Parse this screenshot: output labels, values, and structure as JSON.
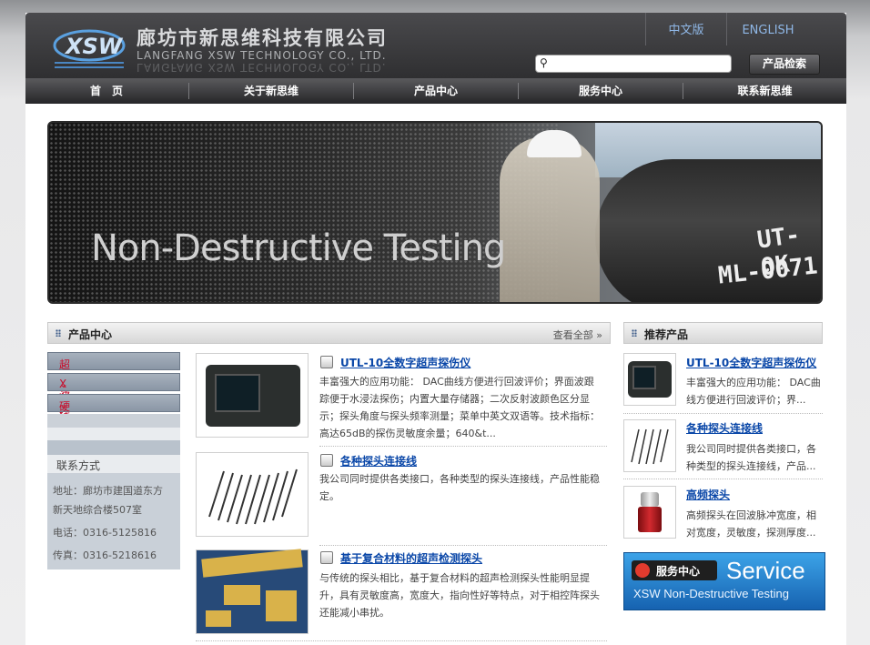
{
  "header": {
    "company_cn": "廊坊市新思维科技有限公司",
    "company_en": "LANGFANG XSW TECHNOLOGY CO., LTD.",
    "lang_cn": "中文版",
    "lang_en": "ENGLISH",
    "search_placeholder": "",
    "search_button": "产品检索"
  },
  "nav": [
    "首　页",
    "关于新思维",
    "产品中心",
    "服务中心",
    "联系新思维"
  ],
  "banner": {
    "title": "Non-Destructive Testing",
    "marks": [
      "UT-OK",
      "ML-0071"
    ]
  },
  "product_center": {
    "title": "产品中心",
    "more": "查看全部"
  },
  "categories": [
    "超声波产品",
    "X射线产品",
    "硬度计"
  ],
  "contact": {
    "title": "联系方式",
    "address_line1": "地址：廊坊市建国道东方",
    "address_line2": "新天地综合楼507室",
    "phone": "电话：0316-5125816",
    "fax": "传真：0316-5218616"
  },
  "products": [
    {
      "title": "UTL-10全数字超声探伤仪",
      "desc": "丰富强大的应用功能： DAC曲线方便进行回波评价；界面波跟踪便于水浸法探伤；内置大量存储器；二次反射波颜色区分显示；探头角度与探头频率测量；菜单中英文双语等。技术指标：高达65dB的探伤灵敏度余量；640&t..."
    },
    {
      "title": "各种探头连接线",
      "desc": "我公司同时提供各类接口，各种类型的探头连接线，产品性能稳定。"
    },
    {
      "title": "基于复合材料的超声检测探头",
      "desc": "与传统的探头相比，基于复合材料的超声检测探头性能明显提升，具有灵敏度高，宽度大，指向性好等特点，对于相控阵探头还能减小串扰。"
    }
  ],
  "recommended": {
    "title": "推荐产品",
    "items": [
      {
        "title": "UTL-10全数字超声探伤仪",
        "desc": "丰富强大的应用功能： DAC曲线方便进行回波评价；界..."
      },
      {
        "title": "各种探头连接线",
        "desc": "我公司同时提供各类接口，各种类型的探头连接线，产品..."
      },
      {
        "title": "高频探头",
        "desc": "高频探头在回波脉冲宽度，相对宽度，灵敏度，探测厚度..."
      }
    ]
  },
  "service_banner": {
    "label_cn": "服务中心",
    "label_en": "Service",
    "subtitle": "XSW Non-Destructive Testing"
  },
  "colors": {
    "link": "#0a47a8",
    "category_text": "#c8102e",
    "lang_text": "#8fb7e6"
  }
}
